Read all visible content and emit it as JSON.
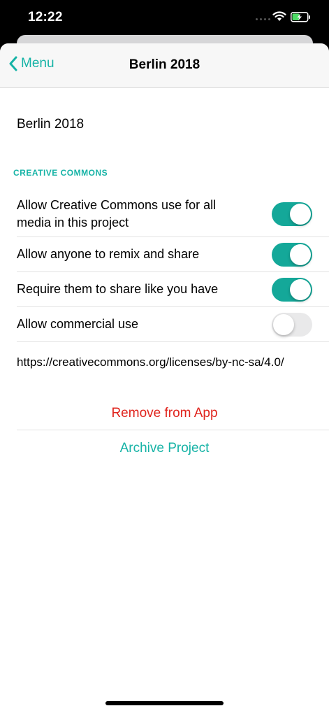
{
  "status_bar": {
    "time": "12:22"
  },
  "nav": {
    "back_label": "Menu",
    "title": "Berlin 2018"
  },
  "project": {
    "name": "Berlin 2018"
  },
  "creative_commons": {
    "section_title": "CREATIVE COMMONS",
    "settings": [
      {
        "label": "Allow Creative Commons use for all media in this project",
        "enabled": true
      },
      {
        "label": "Allow anyone to remix and share",
        "enabled": true
      },
      {
        "label": "Require them to share like you have",
        "enabled": true
      },
      {
        "label": "Allow commercial use",
        "enabled": false
      }
    ],
    "license_url": "https://creativecommons.org/licenses/by-nc-sa/4.0/"
  },
  "actions": {
    "remove_label": "Remove from App",
    "archive_label": "Archive Project"
  },
  "colors": {
    "accent": "#16b3a6",
    "toggle_on": "#14a899",
    "destructive": "#e0241d"
  }
}
